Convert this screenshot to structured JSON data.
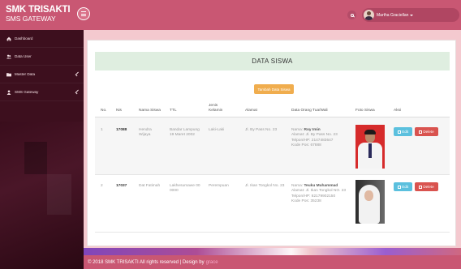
{
  "brand": {
    "title": "SMK TRISAKTI",
    "subtitle": "SMS GATEWAY"
  },
  "sidebar": {
    "items": [
      {
        "label": "Dashboard",
        "icon": "dashboard-icon"
      },
      {
        "label": "Data User",
        "icon": "users-icon"
      },
      {
        "label": "Master Data",
        "icon": "folder-icon"
      },
      {
        "label": "SMS Gateway",
        "icon": "user-icon"
      }
    ]
  },
  "topbar": {
    "user_name": "Martha Graciellan"
  },
  "page": {
    "title": "DATA SISWA",
    "add_button": "Tambah Data Siswa"
  },
  "table": {
    "headers": [
      "No.",
      "Nis",
      "Nama Siswa",
      "TTL",
      "Jenis Kelamin",
      "Alamat",
      "Data Orang Tua/Wali",
      "Foto Siswa",
      "Aksi"
    ],
    "rows": [
      {
        "no": "1",
        "nis": "17088",
        "nama": "Hendra Wijaya",
        "ttl": "Bandar Lampung 19 Maret 2002",
        "jk": "Laki-Laki",
        "alamat": "Jl. By Pass No. 23",
        "wali_label": "Nama:",
        "wali_name": "Roy Imin",
        "wali_alamat": "Alamat: Jl. By Pass No. 23",
        "wali_telp": "Telpon/HP: 2147483647",
        "wali_pos": "Kode Pos: 67888"
      },
      {
        "no": "2",
        "nis": "17037",
        "nama": "Dat Fatimah",
        "ttl": "Lakhesumawe 00 0000",
        "jk": "Perempuan",
        "alamat": "Jl. Ikan Tongkol No. 23",
        "wali_label": "Nama:",
        "wali_name": "Teuku Muhammad",
        "wali_alamat": "Alamat: Jl. Ikan Tongkol NO. 23",
        "wali_telp": "Telpon/HP: 82179902150",
        "wali_pos": "Kode Pos: 35238"
      }
    ],
    "edit_label": "Edit",
    "delete_label": "Delete"
  },
  "footer": {
    "text": "© 2018 SMK TRISAKTI All rights reserved | Design by",
    "author": "grace"
  },
  "colors": {
    "primary": "#c95773",
    "sidebar": "#3d0f1e",
    "edit": "#5bc0de",
    "delete": "#d9534f",
    "warning": "#f0ad4e"
  }
}
